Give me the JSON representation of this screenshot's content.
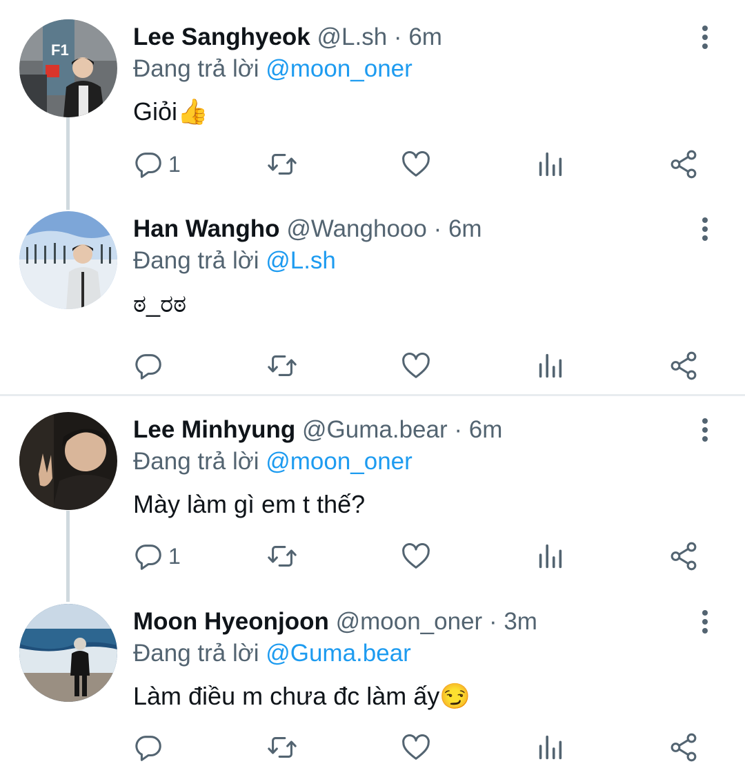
{
  "replying_prefix": "Đang trả lời",
  "tweets": [
    {
      "name": "Lee Sanghyeok",
      "handle": "@L.sh",
      "time": "6m",
      "reply_to": "@moon_oner",
      "text": "Giỏi",
      "emoji": "👍",
      "reply_count": "1",
      "avatar_text": "F1"
    },
    {
      "name": "Han Wangho",
      "handle": "@Wanghooo",
      "time": "6m",
      "reply_to": "@L.sh",
      "text": "ಠ_ರಠ",
      "emoji": "",
      "reply_count": ""
    },
    {
      "name": "Lee Minhyung",
      "handle": "@Guma.bear",
      "time": "6m",
      "reply_to": "@moon_oner",
      "text": "Mày làm gì em t thế?",
      "emoji": "",
      "reply_count": "1"
    },
    {
      "name": "Moon Hyeonjoon",
      "handle": "@moon_oner",
      "time": "3m",
      "reply_to": "@Guma.bear",
      "text": "Làm điều m chưa đc làm ấy",
      "emoji": "😏",
      "reply_count": ""
    }
  ],
  "colors": {
    "text": "#0f1419",
    "secondary": "#536471",
    "link": "#1d9bf0",
    "thread_line": "#cfd9de"
  }
}
